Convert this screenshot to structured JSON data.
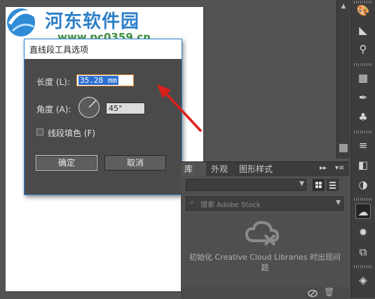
{
  "watermark": {
    "title": "河东软件园",
    "url": "www.pc0359.cn"
  },
  "dialog": {
    "title": "直线段工具选项",
    "length_label": "长度 (L):",
    "length_value": "35.28 mm",
    "angle_label": "角度 (A):",
    "angle_value": "45°",
    "fill_label": "线段填色 (F)",
    "fill_checked": false,
    "ok_label": "确定",
    "cancel_label": "取消"
  },
  "library_panel": {
    "tabs": [
      {
        "label": "库",
        "active": true
      },
      {
        "label": "外观",
        "active": false
      },
      {
        "label": "图形样式",
        "active": false
      }
    ],
    "search_placeholder": "搜索 Adobe Stock",
    "empty_message": "初始化 Creative Cloud Libraries 时出现问题"
  },
  "right_strip": {
    "tools": [
      "palette-icon",
      "gradient-icon",
      "symbol-sprayer-icon",
      "swatches-grid-icon",
      "brush-icon",
      "symbols-club-icon",
      "stroke-icon",
      "gradient-panel-icon",
      "transparency-icon",
      "libraries-icon",
      "appearance-icon",
      "transform-icon",
      "layers-icon"
    ]
  },
  "colors": {
    "accent_blue": "#2b86d9",
    "focus_orange": "#e08a2a",
    "annotation_red": "#d9211c",
    "panel_bg": "#535353"
  }
}
